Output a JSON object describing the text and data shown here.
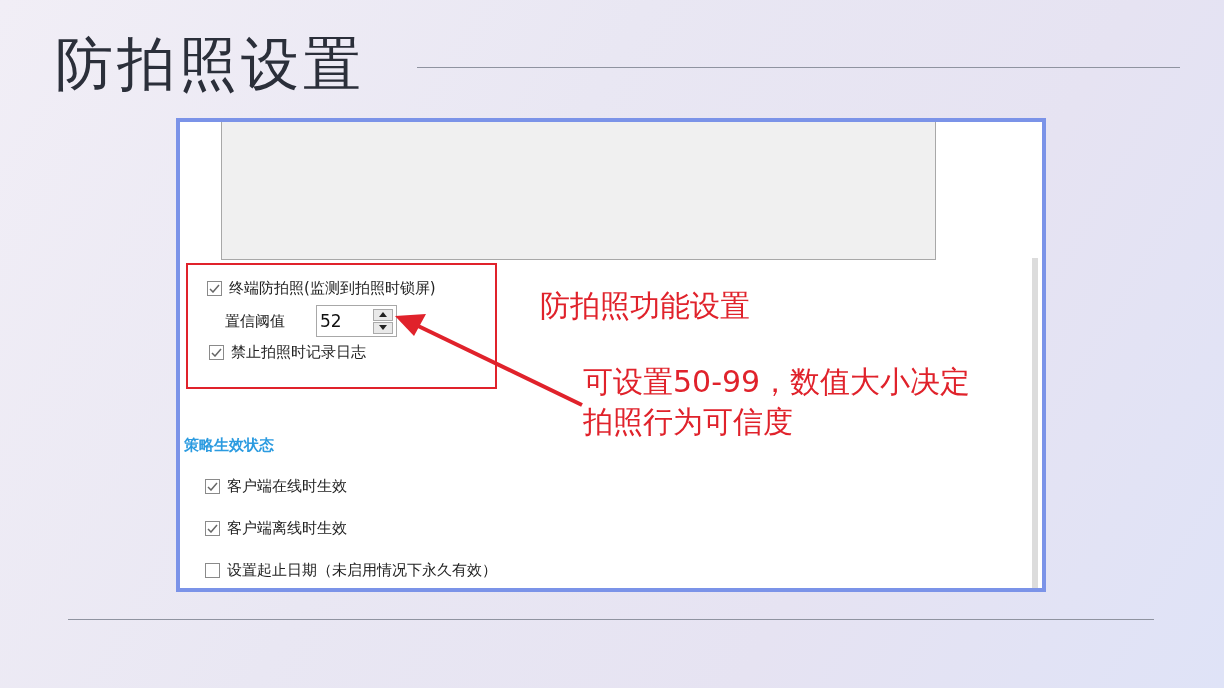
{
  "title": "防拍照设置",
  "screenshot": {
    "photo_protection": {
      "checkbox": {
        "label": "终端防拍照(监测到拍照时锁屏)",
        "checked": true
      },
      "threshold": {
        "label": "置信阈值",
        "value": "52"
      },
      "log_checkbox": {
        "label": "禁止拍照时记录日志",
        "checked": true
      }
    },
    "section_title": "策略生效状态",
    "options": [
      {
        "label": "客户端在线时生效",
        "checked": true
      },
      {
        "label": "客户端离线时生效",
        "checked": true
      },
      {
        "label": "设置起止日期（未启用情况下永久有效）",
        "checked": false
      }
    ]
  },
  "annotations": [
    {
      "lines": [
        "防拍照功能设置"
      ]
    },
    {
      "lines": [
        "可设置50-99，数值大小决定",
        "拍照行为可信度"
      ]
    }
  ]
}
